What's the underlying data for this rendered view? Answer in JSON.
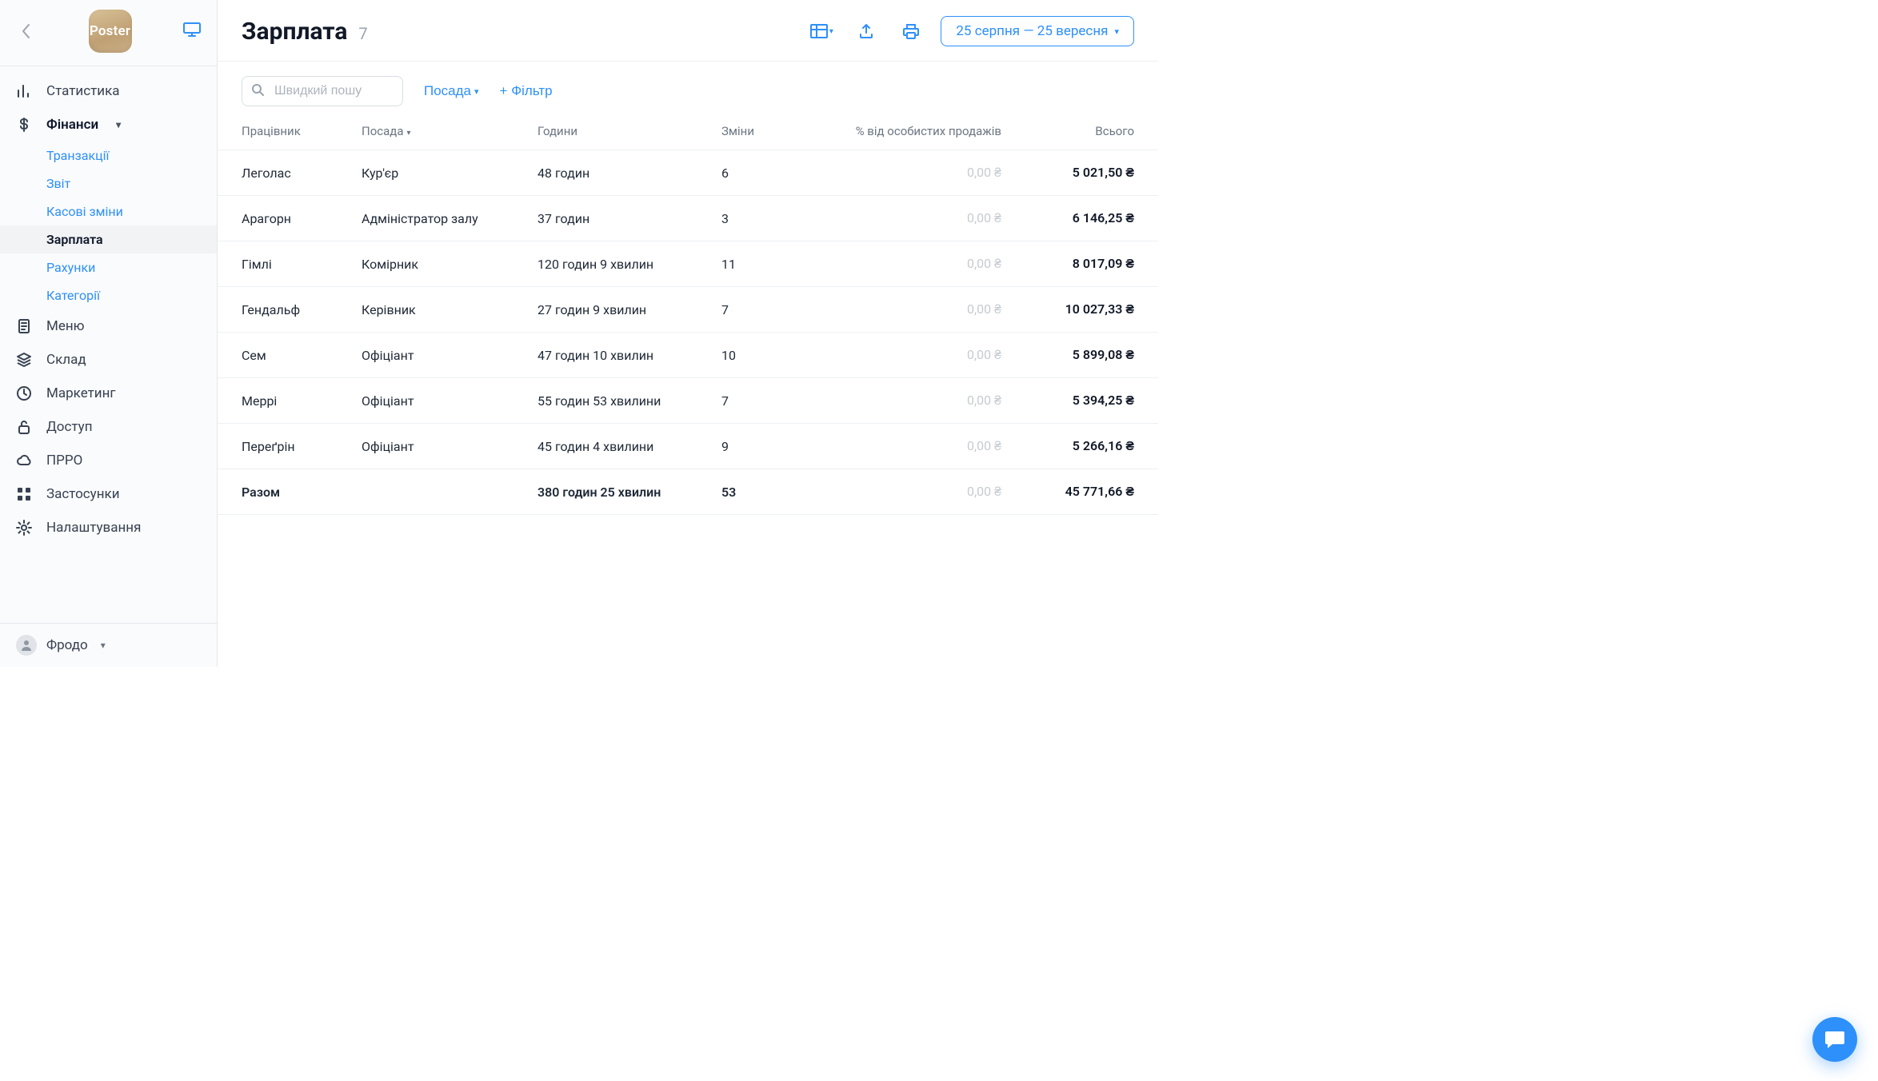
{
  "logo_text": "Poster",
  "sidebar": {
    "items": [
      {
        "label": "Статистика",
        "icon": "bar-chart"
      },
      {
        "label": "Фінанси",
        "icon": "dollar",
        "expanded": true
      },
      {
        "label": "Меню",
        "icon": "document"
      },
      {
        "label": "Склад",
        "icon": "layers"
      },
      {
        "label": "Маркетинг",
        "icon": "clock"
      },
      {
        "label": "Доступ",
        "icon": "lock"
      },
      {
        "label": "ПРРО",
        "icon": "cloud"
      },
      {
        "label": "Застосунки",
        "icon": "grid"
      },
      {
        "label": "Налаштування",
        "icon": "gear"
      }
    ],
    "finance_sub": [
      "Транзакції",
      "Звіт",
      "Касові зміни",
      "Зарплата",
      "Рахунки",
      "Категорії"
    ]
  },
  "user_name": "Фродо",
  "header": {
    "title": "Зарплата",
    "count": "7",
    "date_range": "25 серпня — 25 вересня"
  },
  "toolbar": {
    "search_placeholder": "Швидкий пошу",
    "position_label": "Посада",
    "filter_label": "+ Фільтр"
  },
  "columns": {
    "employee": "Працівник",
    "position": "Посада",
    "hours": "Години",
    "shifts": "Зміни",
    "pct": "% від особистих продажів",
    "total": "Всього"
  },
  "rows": [
    {
      "employee": "Леголас",
      "position": "Кур'єр",
      "hours": "48 годин",
      "shifts": "6",
      "pct": "0,00 ₴",
      "total": "5 021,50 ₴"
    },
    {
      "employee": "Арагорн",
      "position": "Адміністратор залу",
      "hours": "37 годин",
      "shifts": "3",
      "pct": "0,00 ₴",
      "total": "6 146,25 ₴"
    },
    {
      "employee": "Гімлі",
      "position": "Комірник",
      "hours": "120 годин 9 хвилин",
      "shifts": "11",
      "pct": "0,00 ₴",
      "total": "8 017,09 ₴"
    },
    {
      "employee": "Гендальф",
      "position": "Керівник",
      "hours": "27 годин 9 хвилин",
      "shifts": "7",
      "pct": "0,00 ₴",
      "total": "10 027,33 ₴"
    },
    {
      "employee": "Сем",
      "position": "Офіціант",
      "hours": "47 годин 10 хвилин",
      "shifts": "10",
      "pct": "0,00 ₴",
      "total": "5 899,08 ₴"
    },
    {
      "employee": "Меррі",
      "position": "Офіціант",
      "hours": "55 годин 53 хвилини",
      "shifts": "7",
      "pct": "0,00 ₴",
      "total": "5 394,25 ₴"
    },
    {
      "employee": "Переґрін",
      "position": "Офіціант",
      "hours": "45 годин 4 хвилини",
      "shifts": "9",
      "pct": "0,00 ₴",
      "total": "5 266,16 ₴"
    }
  ],
  "totals": {
    "label": "Разом",
    "hours": "380 годин 25 хвилин",
    "shifts": "53",
    "pct": "0,00 ₴",
    "total": "45 771,66 ₴"
  }
}
